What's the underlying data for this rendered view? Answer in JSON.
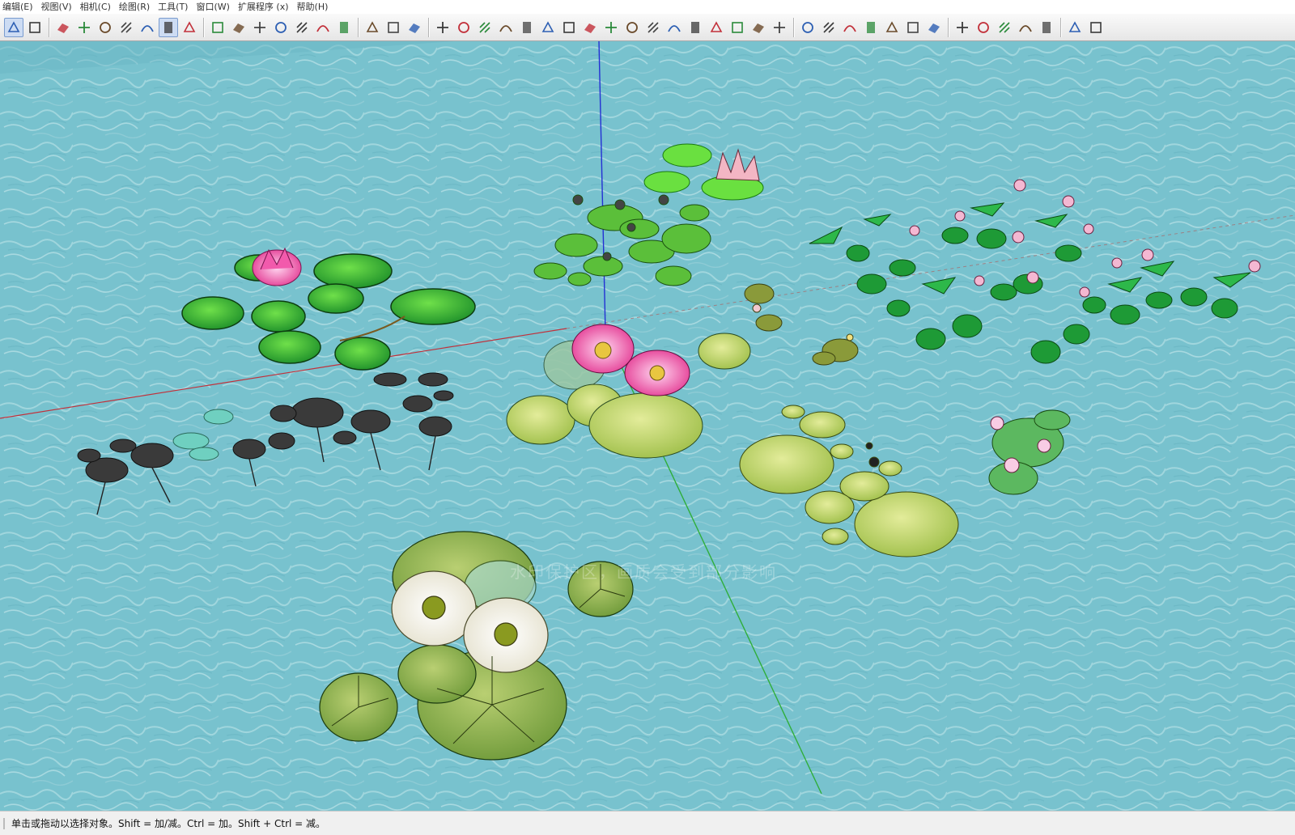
{
  "menubar": {
    "items": [
      "编辑(E)",
      "视图(V)",
      "相机(C)",
      "绘图(R)",
      "工具(T)",
      "窗口(W)",
      "扩展程序 (x)",
      "帮助(H)"
    ]
  },
  "toolbar": {
    "groups": [
      [
        "select-icon",
        "component-icon"
      ],
      [
        "eraser-icon",
        "paint-bucket-icon",
        "wireframe-icon",
        "hidden-line-icon",
        "shaded-icon",
        "shaded-texture-icon",
        "monochrome-icon"
      ],
      [
        "sandbox-icon",
        "terrain-icon",
        "stamp-icon",
        "drape-icon",
        "flip-edge-icon",
        "smoove-icon",
        "add-detail-icon"
      ],
      [
        "table-icon",
        "layout-icon",
        "grid-icon"
      ],
      [
        "stairs-icon",
        "window-icon",
        "ramp-icon",
        "bars-icon",
        "pipe-icon",
        "offset-icon",
        "bend-icon",
        "curve-icon",
        "arc-icon",
        "loop-icon",
        "spiral-icon",
        "line-icon",
        "joint-icon",
        "fold-icon",
        "unfold-icon",
        "push-icon",
        "twist-icon"
      ],
      [
        "dome-icon",
        "chain-icon",
        "wave-icon",
        "orbit-icon",
        "axe-icon",
        "railing-icon",
        "column-icon"
      ],
      [
        "mirror-icon",
        "array-icon",
        "box-icon",
        "tree-icon",
        "brush-icon"
      ],
      [
        "plugin-a-icon",
        "plugin-s-icon"
      ]
    ]
  },
  "viewport": {
    "watermark": "水印保护区，画质会受到部分影响",
    "colors": {
      "water": "#7cc3cf",
      "axis_red": "#c2303a",
      "axis_green": "#2fae3a",
      "axis_blue": "#2430d4"
    }
  },
  "statusbar": {
    "text": "单击或拖动以选择对象。Shift = 加/减。Ctrl = 加。Shift + Ctrl = 减。"
  }
}
